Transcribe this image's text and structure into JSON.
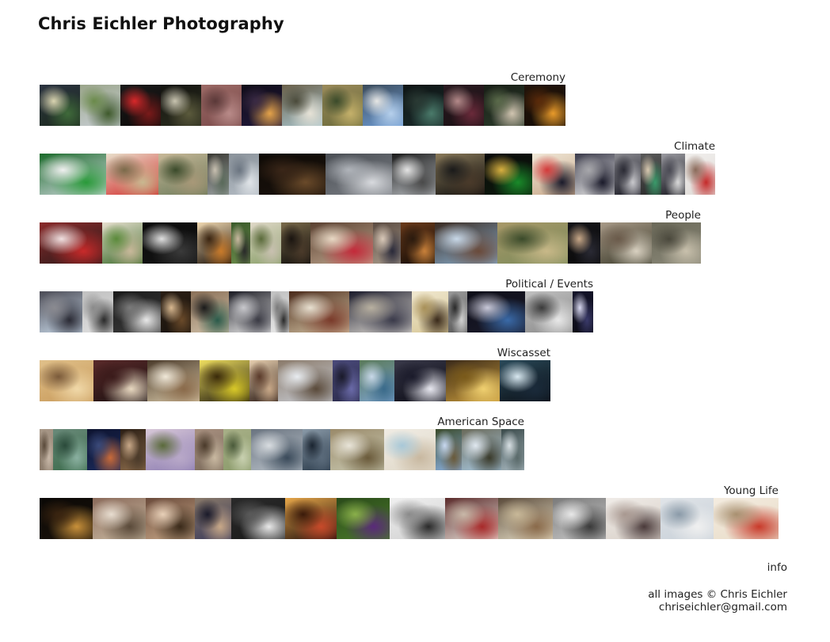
{
  "site": {
    "title": "Chris Eichler Photography"
  },
  "galleries": [
    {
      "label": "Ceremony",
      "thumbnails": [
        {
          "subject": "stadium at night",
          "colors": [
            "#1c2a1e",
            "#3f6a3a",
            "#d9d4b0",
            "#2b3340"
          ]
        },
        {
          "subject": "tree on lawn",
          "colors": [
            "#c9cfd6",
            "#3f5a2c",
            "#6a8a4a",
            "#9aa58a"
          ]
        },
        {
          "subject": "red object at night",
          "colors": [
            "#0d0b0a",
            "#7a1a1a",
            "#d8282a",
            "#1a1a1a"
          ]
        },
        {
          "subject": "people in dark field",
          "colors": [
            "#2a2c1e",
            "#5b5a3c",
            "#c8c4b0",
            "#141410"
          ]
        },
        {
          "subject": "pink figure",
          "colors": [
            "#7a4a4a",
            "#b88a88",
            "#5a3838",
            "#9c6a66"
          ]
        },
        {
          "subject": "dusk skyline",
          "colors": [
            "#20183a",
            "#e3a24a",
            "#3a2a44",
            "#100c18"
          ]
        },
        {
          "subject": "crowd under sky",
          "colors": [
            "#a8c4cc",
            "#e6e2d6",
            "#4a4a3a",
            "#6a604a"
          ]
        },
        {
          "subject": "parade",
          "colors": [
            "#6a6a3a",
            "#c4b06a",
            "#3a4a2a",
            "#9a8a5a"
          ]
        },
        {
          "subject": "washington monument",
          "colors": [
            "#6e9cd4",
            "#b6d0ec",
            "#e6e6e4",
            "#3a4a5a"
          ]
        },
        {
          "subject": "people at night green",
          "colors": [
            "#1a2a2a",
            "#4a7a6a",
            "#2a3a34",
            "#0e1414"
          ]
        },
        {
          "subject": "audience at night",
          "colors": [
            "#1a1014",
            "#6a2a3a",
            "#b48a8a",
            "#2a1a20"
          ]
        },
        {
          "subject": "group seated",
          "colors": [
            "#2a3a2a",
            "#d0c4b0",
            "#5a6a4a",
            "#181e16"
          ]
        },
        {
          "subject": "bonfire",
          "colors": [
            "#140c06",
            "#e89a2a",
            "#5a2a0a",
            "#22140a"
          ]
        }
      ]
    },
    {
      "label": "Climate",
      "thumbnails": [
        {
          "subject": "capitol protest",
          "colors": [
            "#d6dce4",
            "#2a9a3a",
            "#f0f0f0",
            "#1a6a2a"
          ]
        },
        {
          "subject": "man with hat",
          "colors": [
            "#d22a2a",
            "#c8b890",
            "#7a6a4a",
            "#e8e0cc"
          ]
        },
        {
          "subject": "group outdoors",
          "colors": [
            "#6a7a5a",
            "#a89878",
            "#3a4a2a",
            "#c8b898"
          ]
        },
        {
          "subject": "older couple",
          "colors": [
            "#9aa0a0",
            "#5a6a5a",
            "#c8c0b0",
            "#3a3a34"
          ]
        },
        {
          "subject": "foggy landscape",
          "colors": [
            "#b4bcc4",
            "#e0e4e8",
            "#6a7480",
            "#8a929a"
          ]
        },
        {
          "subject": "dark auditorium",
          "colors": [
            "#1a120c",
            "#6a4a2a",
            "#3a2618",
            "#0e0a06"
          ]
        },
        {
          "subject": "hand on whiteboard",
          "colors": [
            "#7a7e84",
            "#d8dade",
            "#b0b4ba",
            "#4a4e54"
          ]
        },
        {
          "subject": "street scene",
          "colors": [
            "#b8bcc0",
            "#4a4a4a",
            "#e4e4e4",
            "#1a1a1a"
          ]
        },
        {
          "subject": "speaker dark stage",
          "colors": [
            "#0c0c0c",
            "#4a3a2a",
            "#1a1a1a",
            "#8a7a5a"
          ]
        },
        {
          "subject": "green podium",
          "colors": [
            "#0c1a0c",
            "#1a8a2a",
            "#d8b040",
            "#0a0a0a"
          ]
        },
        {
          "subject": "man in suit flags",
          "colors": [
            "#c8a88a",
            "#1a1a2a",
            "#d43a3a",
            "#f0e8d8"
          ]
        },
        {
          "subject": "police line",
          "colors": [
            "#e6e6e6",
            "#1a1a2a",
            "#a8a8ac",
            "#3a3a4a"
          ]
        },
        {
          "subject": "officers",
          "colors": [
            "#1a1a24",
            "#c8c8cc",
            "#2a2a34",
            "#8a8a90"
          ]
        },
        {
          "subject": "woman green shirt",
          "colors": [
            "#2a2a2a",
            "#3a9a6a",
            "#d8c8b0",
            "#5a5a5a"
          ]
        },
        {
          "subject": "officer close",
          "colors": [
            "#1a1a22",
            "#d8d8d8",
            "#4a4a54",
            "#9a9aa0"
          ]
        },
        {
          "subject": "woman red coat",
          "colors": [
            "#e0dcd8",
            "#c42a2a",
            "#8a6a5a",
            "#f0eeec"
          ]
        }
      ]
    },
    {
      "label": "People",
      "thumbnails": [
        {
          "subject": "red polka dress",
          "colors": [
            "#2a1a1a",
            "#c82a2a",
            "#f0e0e0",
            "#8a2a2a"
          ]
        },
        {
          "subject": "house garden",
          "colors": [
            "#3a6a2a",
            "#c8b89a",
            "#5a8a3a",
            "#e8e0d0"
          ]
        },
        {
          "subject": "person in snow",
          "colors": [
            "#141414",
            "#3a3a3a",
            "#e0e0e0",
            "#0a0a0a"
          ]
        },
        {
          "subject": "girl night swing",
          "colors": [
            "#1a1008",
            "#c87a2a",
            "#3a2410",
            "#f0d8b0"
          ]
        },
        {
          "subject": "man standing",
          "colors": [
            "#6a8a4a",
            "#2a2a2a",
            "#c8b8a0",
            "#3a5a2a"
          ]
        },
        {
          "subject": "older man outdoors",
          "colors": [
            "#8aa06a",
            "#c8c0b0",
            "#5a6a3a",
            "#e0d8c8"
          ]
        },
        {
          "subject": "dark room figure",
          "colors": [
            "#0e0c0a",
            "#4a3a2a",
            "#1a1410",
            "#7a6a4a"
          ]
        },
        {
          "subject": "woman red hoodie",
          "colors": [
            "#c0a890",
            "#c42a3a",
            "#e8d8c4",
            "#5a4030"
          ]
        },
        {
          "subject": "person pointing",
          "colors": [
            "#a89a8a",
            "#2a2a3a",
            "#d8c8b8",
            "#5a4a40"
          ]
        },
        {
          "subject": "dark portrait",
          "colors": [
            "#140c06",
            "#c8803a",
            "#2a1a0e",
            "#6a3a1a"
          ]
        },
        {
          "subject": "roller coaster",
          "colors": [
            "#8ab0d0",
            "#6a4a3a",
            "#c8d8e8",
            "#3a2a20"
          ]
        },
        {
          "subject": "atv field",
          "colors": [
            "#7a8a5a",
            "#c8b888",
            "#3a4a2a",
            "#a89868"
          ]
        },
        {
          "subject": "young man dark",
          "colors": [
            "#0a0a0a",
            "#2a2a34",
            "#c8a888",
            "#141418"
          ]
        },
        {
          "subject": "man bench",
          "colors": [
            "#3a3a2a",
            "#d8d0c0",
            "#6a5a4a",
            "#a89a88"
          ]
        },
        {
          "subject": "older man portrait",
          "colors": [
            "#8a8878",
            "#c8c0ac",
            "#4a483c",
            "#6a6858"
          ]
        }
      ]
    },
    {
      "label": "Political / Events",
      "thumbnails": [
        {
          "subject": "marching crowd",
          "colors": [
            "#c8d8e8",
            "#2a2a34",
            "#8a8a90",
            "#4a4a54"
          ]
        },
        {
          "subject": "speaker bw",
          "colors": [
            "#e0e0e0",
            "#2a2a2a",
            "#8a8a8a",
            "#c0c0c0"
          ]
        },
        {
          "subject": "older man bw",
          "colors": [
            "#3a3a3a",
            "#e8e8e8",
            "#7a7a7a",
            "#1a1a1a"
          ]
        },
        {
          "subject": "man dark office",
          "colors": [
            "#1a140e",
            "#6a4a2a",
            "#d8b890",
            "#2a1e14"
          ]
        },
        {
          "subject": "two people",
          "colors": [
            "#d0c0a8",
            "#2a5a4a",
            "#1a1a1a",
            "#8a7058"
          ]
        },
        {
          "subject": "press conference",
          "colors": [
            "#ececec",
            "#3a3a44",
            "#c8c8cc",
            "#1a1a22"
          ]
        },
        {
          "subject": "woman speaking",
          "colors": [
            "#e8e8e8",
            "#2a2a2a",
            "#7a7a7a",
            "#c0c0c0"
          ]
        },
        {
          "subject": "assembly hall",
          "colors": [
            "#d8c8a8",
            "#7a3a2a",
            "#e8e0d0",
            "#4a2a1a"
          ]
        },
        {
          "subject": "panel group",
          "colors": [
            "#e8e4dc",
            "#3a3a4a",
            "#b8b0a0",
            "#1a1a2a"
          ]
        },
        {
          "subject": "men standing hall",
          "colors": [
            "#d8c898",
            "#3a2a1a",
            "#a89058",
            "#f0e8d0"
          ]
        },
        {
          "subject": "crowd bw",
          "colors": [
            "#5a5a5a",
            "#d0d0d0",
            "#2a2a2a",
            "#9a9a9a"
          ]
        },
        {
          "subject": "speaker blue podium",
          "colors": [
            "#1a1a2a",
            "#3a6aa8",
            "#c8c8d8",
            "#0e0e18"
          ]
        },
        {
          "subject": "audience bw",
          "colors": [
            "#8a8a8a",
            "#e8e8e8",
            "#3a3a3a",
            "#c0c0c0"
          ]
        },
        {
          "subject": "night rally",
          "colors": [
            "#0a0a14",
            "#3a3a6a",
            "#d8d8f0",
            "#14142a"
          ]
        }
      ]
    },
    {
      "label": "Wiscasset",
      "thumbnails": [
        {
          "subject": "interior window",
          "colors": [
            "#c89a5a",
            "#f0d8a8",
            "#7a5a3a",
            "#e0c08a"
          ]
        },
        {
          "subject": "dark window",
          "colors": [
            "#1a1010",
            "#e8d8c0",
            "#3a1a1a",
            "#5a2a2a"
          ]
        },
        {
          "subject": "room clutter",
          "colors": [
            "#d8c8a8",
            "#8a6a4a",
            "#f0e8d8",
            "#4a3a2a"
          ]
        },
        {
          "subject": "yellow raincoat",
          "colors": [
            "#1a140a",
            "#d8c828",
            "#3a2a0a",
            "#f0e060"
          ]
        },
        {
          "subject": "doorway interior",
          "colors": [
            "#2a1a14",
            "#c8a888",
            "#5a3a2a",
            "#e8d0b0"
          ]
        },
        {
          "subject": "snowy street",
          "colors": [
            "#c8ccd4",
            "#5a4a3a",
            "#e8ecf0",
            "#8a7a6a"
          ]
        },
        {
          "subject": "night sky",
          "colors": [
            "#2a2a4a",
            "#6a6aa8",
            "#1a1a2a",
            "#4a4a7a"
          ]
        },
        {
          "subject": "blue houses",
          "colors": [
            "#7aa0c8",
            "#3a6a8a",
            "#c8d8e8",
            "#5a7a5a"
          ]
        },
        {
          "subject": "moon branches",
          "colors": [
            "#0a0a14",
            "#e8e8f0",
            "#1a1a2a",
            "#3a3a4a"
          ]
        },
        {
          "subject": "yellow room",
          "colors": [
            "#c89a3a",
            "#f0d070",
            "#7a5a1a",
            "#3a2a1a"
          ]
        },
        {
          "subject": "night field lights",
          "colors": [
            "#0a0e14",
            "#1a2a3a",
            "#d8e8f0",
            "#2a4a5a"
          ]
        }
      ]
    },
    {
      "label": "American Space",
      "thumbnails": [
        {
          "subject": "road landscape",
          "colors": [
            "#8a7a6a",
            "#c8b8a8",
            "#5a4a3a",
            "#a89888"
          ]
        },
        {
          "subject": "green trees",
          "colors": [
            "#3a6a4a",
            "#8ab0a0",
            "#2a4a3a",
            "#6a8a7a"
          ]
        },
        {
          "subject": "blue sunset",
          "colors": [
            "#1a2a5a",
            "#c86a3a",
            "#3a4a7a",
            "#0e1430"
          ]
        },
        {
          "subject": "building ruin",
          "colors": [
            "#8a6a4a",
            "#4a3a2a",
            "#c8a888",
            "#2a1e14"
          ]
        },
        {
          "subject": "purple sky field",
          "colors": [
            "#8a7ab0",
            "#b8a8c8",
            "#5a6a3a",
            "#d8c8d8"
          ]
        },
        {
          "subject": "winding river aerial",
          "colors": [
            "#7a6a5a",
            "#c8b8a0",
            "#4a3a2a",
            "#a89080"
          ]
        },
        {
          "subject": "forest edge",
          "colors": [
            "#8a9a6a",
            "#c8d0b0",
            "#4a5a3a",
            "#a8b088"
          ]
        },
        {
          "subject": "sea wall",
          "colors": [
            "#b8c0c8",
            "#3a4a5a",
            "#d8dce0",
            "#6a7480"
          ]
        },
        {
          "subject": "dark dune",
          "colors": [
            "#2a3a4a",
            "#5a6a7a",
            "#1a2430",
            "#8a9aa8"
          ]
        },
        {
          "subject": "lone tree",
          "colors": [
            "#c8c8b0",
            "#6a5a3a",
            "#e8e4d8",
            "#9a8a6a"
          ]
        },
        {
          "subject": "beach",
          "colors": [
            "#e0d8c8",
            "#c8b8a0",
            "#a8c8d8",
            "#f0ece4"
          ]
        },
        {
          "subject": "joshua tree",
          "colors": [
            "#8ab0e0",
            "#6a5a3a",
            "#c8d8f0",
            "#3a4a2a"
          ]
        },
        {
          "subject": "telephone pole",
          "colors": [
            "#a8c8e0",
            "#3a3a2a",
            "#e0e8f0",
            "#6a6a5a"
          ]
        },
        {
          "subject": "parking lot",
          "colors": [
            "#a8b8c0",
            "#5a6a6a",
            "#d8e0e4",
            "#3a4a4a"
          ]
        }
      ]
    },
    {
      "label": "Young Life",
      "thumbnails": [
        {
          "subject": "dark room light",
          "colors": [
            "#1a120a",
            "#c8903a",
            "#3a2410",
            "#0a0806"
          ]
        },
        {
          "subject": "young men outdoor",
          "colors": [
            "#c8b8a0",
            "#5a4a3a",
            "#e8ddd0",
            "#8a6a5a"
          ]
        },
        {
          "subject": "group laughing",
          "colors": [
            "#c8a888",
            "#3a2a1a",
            "#e8d0b8",
            "#6a4a3a"
          ]
        },
        {
          "subject": "friends bar",
          "colors": [
            "#3a3a5a",
            "#c8a888",
            "#1a1a2a",
            "#8a7a6a"
          ]
        },
        {
          "subject": "bw screen",
          "colors": [
            "#1a1a1a",
            "#e8e8e8",
            "#5a5a5a",
            "#2a2a2a"
          ]
        },
        {
          "subject": "colorful dark",
          "colors": [
            "#1a0a0a",
            "#c84a2a",
            "#3a1a0a",
            "#e8a84a"
          ]
        },
        {
          "subject": "person on grass",
          "colors": [
            "#4a7a2a",
            "#5a2a7a",
            "#8ab04a",
            "#2a4a1a"
          ]
        },
        {
          "subject": "bw reclining",
          "colors": [
            "#d0d0d0",
            "#2a2a2a",
            "#8a8a8a",
            "#f0f0f0"
          ]
        },
        {
          "subject": "red blanket",
          "colors": [
            "#e8e0d8",
            "#a82a2a",
            "#c8b8a8",
            "#5a2a2a"
          ]
        },
        {
          "subject": "bearded man",
          "colors": [
            "#e8e0c8",
            "#8a6a4a",
            "#c8b898",
            "#5a4a3a"
          ]
        },
        {
          "subject": "bw desk",
          "colors": [
            "#c8c8c8",
            "#3a3a3a",
            "#e8e8e8",
            "#7a7a7a"
          ]
        },
        {
          "subject": "man at window",
          "colors": [
            "#d8d0c8",
            "#4a3a3a",
            "#a89890",
            "#f0ece8"
          ]
        },
        {
          "subject": "bed scene",
          "colors": [
            "#c8d0d8",
            "#f0f0f0",
            "#8a9aa8",
            "#e0e4e8"
          ]
        },
        {
          "subject": "woman red",
          "colors": [
            "#e8dcc8",
            "#c83a2a",
            "#a89070",
            "#f4ece0"
          ]
        }
      ]
    }
  ],
  "nav": {
    "info_label": "info"
  },
  "footer": {
    "copyright": "all images © Chris Eichler",
    "email": "chriseichler@gmail.com"
  }
}
